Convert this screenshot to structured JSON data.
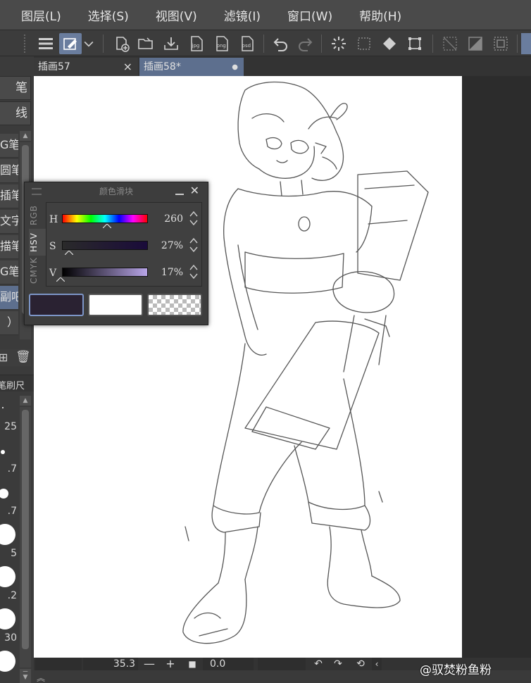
{
  "menu": [
    "图层(L)",
    "选择(S)",
    "视图(V)",
    "滤镜(I)",
    "窗口(W)",
    "帮助(H)"
  ],
  "tabs": [
    {
      "label": "插画57",
      "close": "×"
    },
    {
      "label": "插画58*",
      "close": "●"
    }
  ],
  "left_panel": {
    "tool_buttons": [
      "笔",
      "线"
    ],
    "sub_tools": [
      "G笔",
      "圆笔",
      "插笔",
      "文字",
      "描笔",
      "G笔",
      "副吧",
      "）"
    ],
    "brush_panel_label": "笔刷尺",
    "brush_sizes": [
      "25",
      ".7",
      ".7",
      "5",
      ".2",
      "30"
    ]
  },
  "color_panel": {
    "title": "颜色滑块",
    "tabs": [
      "RGB",
      "HSV",
      "CMYK"
    ],
    "active_tab": "HSV",
    "sliders": [
      {
        "label": "H",
        "value": "260"
      },
      {
        "label": "S",
        "value": "27%"
      },
      {
        "label": "V",
        "value": "17%"
      }
    ],
    "main_color": "#2a2232",
    "sub_color": "#ffffff"
  },
  "status": {
    "zoom": "35.3",
    "angle": "0.0"
  },
  "watermark": "@驭焚粉鱼粉",
  "colors": {
    "menubar": "#4a4a4a",
    "accent": "#6a7d9e",
    "canvas": "#ffffff"
  }
}
